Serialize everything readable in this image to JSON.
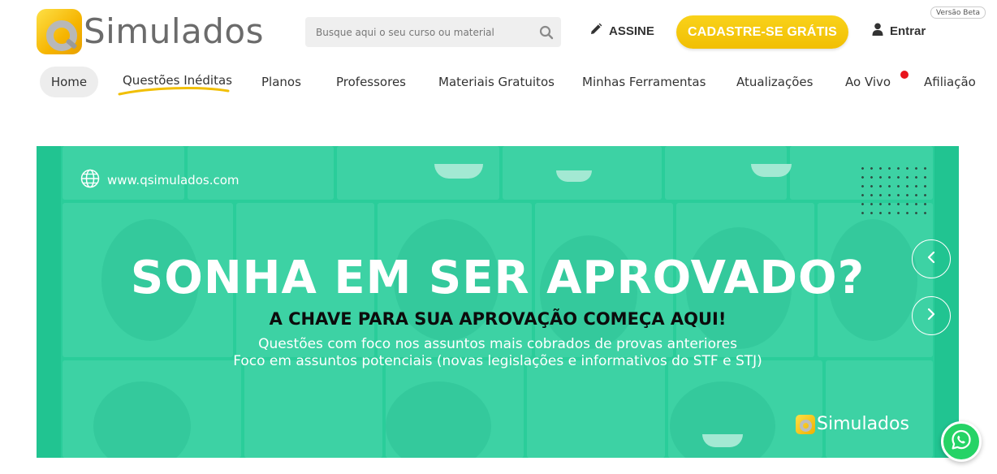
{
  "header": {
    "logo_text": "Simulados",
    "search_placeholder": "Busque aqui o seu curso ou material",
    "assine_label": "ASSINE",
    "cta_label": "CADASTRE-SE GRÁTIS",
    "entrar_label": "Entrar",
    "beta_badge": "Versão Beta"
  },
  "nav": {
    "items": [
      {
        "label": "Home"
      },
      {
        "label": "Questões Inéditas"
      },
      {
        "label": "Planos"
      },
      {
        "label": "Professores"
      },
      {
        "label": "Materiais Gratuitos"
      },
      {
        "label": "Minhas Ferramentas"
      },
      {
        "label": "Atualizações"
      },
      {
        "label": "Ao Vivo"
      },
      {
        "label": "Afiliação"
      }
    ]
  },
  "banner": {
    "site_url": "www.qsimulados.com",
    "headline": "SONHA EM SER APROVADO?",
    "subheadline": "A CHAVE PARA SUA APROVAÇÃO COMEÇA AQUI!",
    "line1": "Questões com foco nos assuntos mais cobrados de provas anteriores",
    "line2": "Foco em assuntos potenciais (novas legislações e informativos do STF e STJ)",
    "logo_text": "Simulados"
  },
  "colors": {
    "accent_yellow": "#f1bf04",
    "banner_green": "#2fcf9d",
    "live_red": "#e8141c",
    "whatsapp_green": "#25d366"
  },
  "icons": {
    "search": "search-icon",
    "pencil": "pencil-icon",
    "user": "user-icon",
    "globe": "globe-icon",
    "prev": "chevron-left-icon",
    "next": "chevron-right-icon",
    "whatsapp": "whatsapp-icon"
  }
}
